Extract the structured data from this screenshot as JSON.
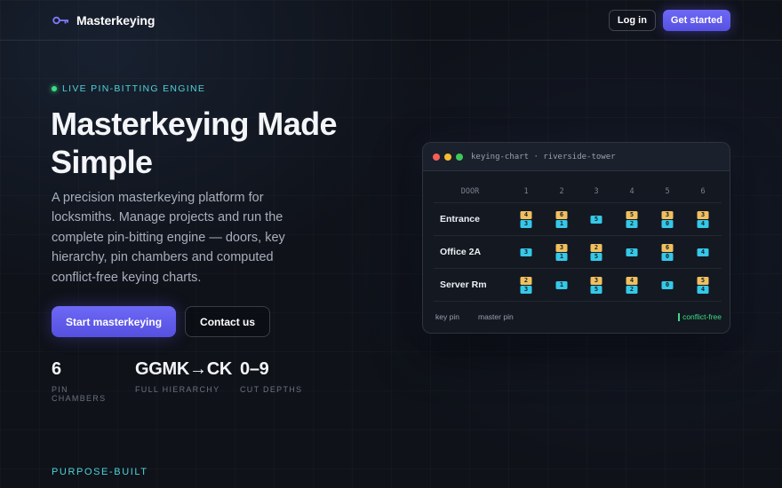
{
  "nav": {
    "brand": "Masterkeying",
    "login_label": "Log in",
    "get_started_label": "Get started"
  },
  "hero": {
    "eyebrow": "LIVE PIN-BITTING ENGINE",
    "headline": "Masterkeying Made Simple",
    "lede": "A precision masterkeying platform for locksmiths. Manage projects and run the complete pin-bitting engine — doors, key hierarchy, pin chambers and computed conflict-free keying charts.",
    "primary_cta": "Start masterkeying",
    "secondary_cta": "Contact us",
    "stats": [
      {
        "value": "6",
        "label": "PIN CHAMBERS"
      },
      {
        "value": "GGMK→CK",
        "label": "FULL HIERARCHY"
      },
      {
        "value": "0–9",
        "label": "CUT DEPTHS"
      }
    ]
  },
  "section": {
    "eyebrow": "PURPOSE-BUILT"
  },
  "keying_chart": {
    "title": "keying-chart · riverside-tower",
    "door_header": "DOOR",
    "chambers": [
      "1",
      "2",
      "3",
      "4",
      "5",
      "6"
    ],
    "rows": [
      {
        "door": "Entrance",
        "pins": [
          {
            "master": "4",
            "key": "3"
          },
          {
            "master": "6",
            "key": "1"
          },
          {
            "master": "",
            "key": "5"
          },
          {
            "master": "5",
            "key": "2"
          },
          {
            "master": "3",
            "key": "0"
          },
          {
            "master": "3",
            "key": "4"
          }
        ]
      },
      {
        "door": "Office 2A",
        "pins": [
          {
            "master": "",
            "key": "3"
          },
          {
            "master": "3",
            "key": "1"
          },
          {
            "master": "2",
            "key": "5"
          },
          {
            "master": "",
            "key": "2"
          },
          {
            "master": "6",
            "key": "0"
          },
          {
            "master": "",
            "key": "4"
          }
        ]
      },
      {
        "door": "Server Rm",
        "pins": [
          {
            "master": "2",
            "key": "3"
          },
          {
            "master": "",
            "key": "1"
          },
          {
            "master": "3",
            "key": "5"
          },
          {
            "master": "4",
            "key": "2"
          },
          {
            "master": "",
            "key": "0"
          },
          {
            "master": "5",
            "key": "4"
          }
        ]
      }
    ],
    "legend": {
      "key_pin": "key pin",
      "master_pin": "master pin",
      "status": "conflict-free"
    },
    "colors": {
      "master_pin": "#f0c060",
      "key_pin": "#35c8e8",
      "status": "#3ddc84"
    }
  },
  "colors": {
    "accent": "#5f5aee",
    "cyan": "#4fd1d9",
    "background": "#0f1219"
  },
  "icons": {
    "brand": "key-icon"
  }
}
